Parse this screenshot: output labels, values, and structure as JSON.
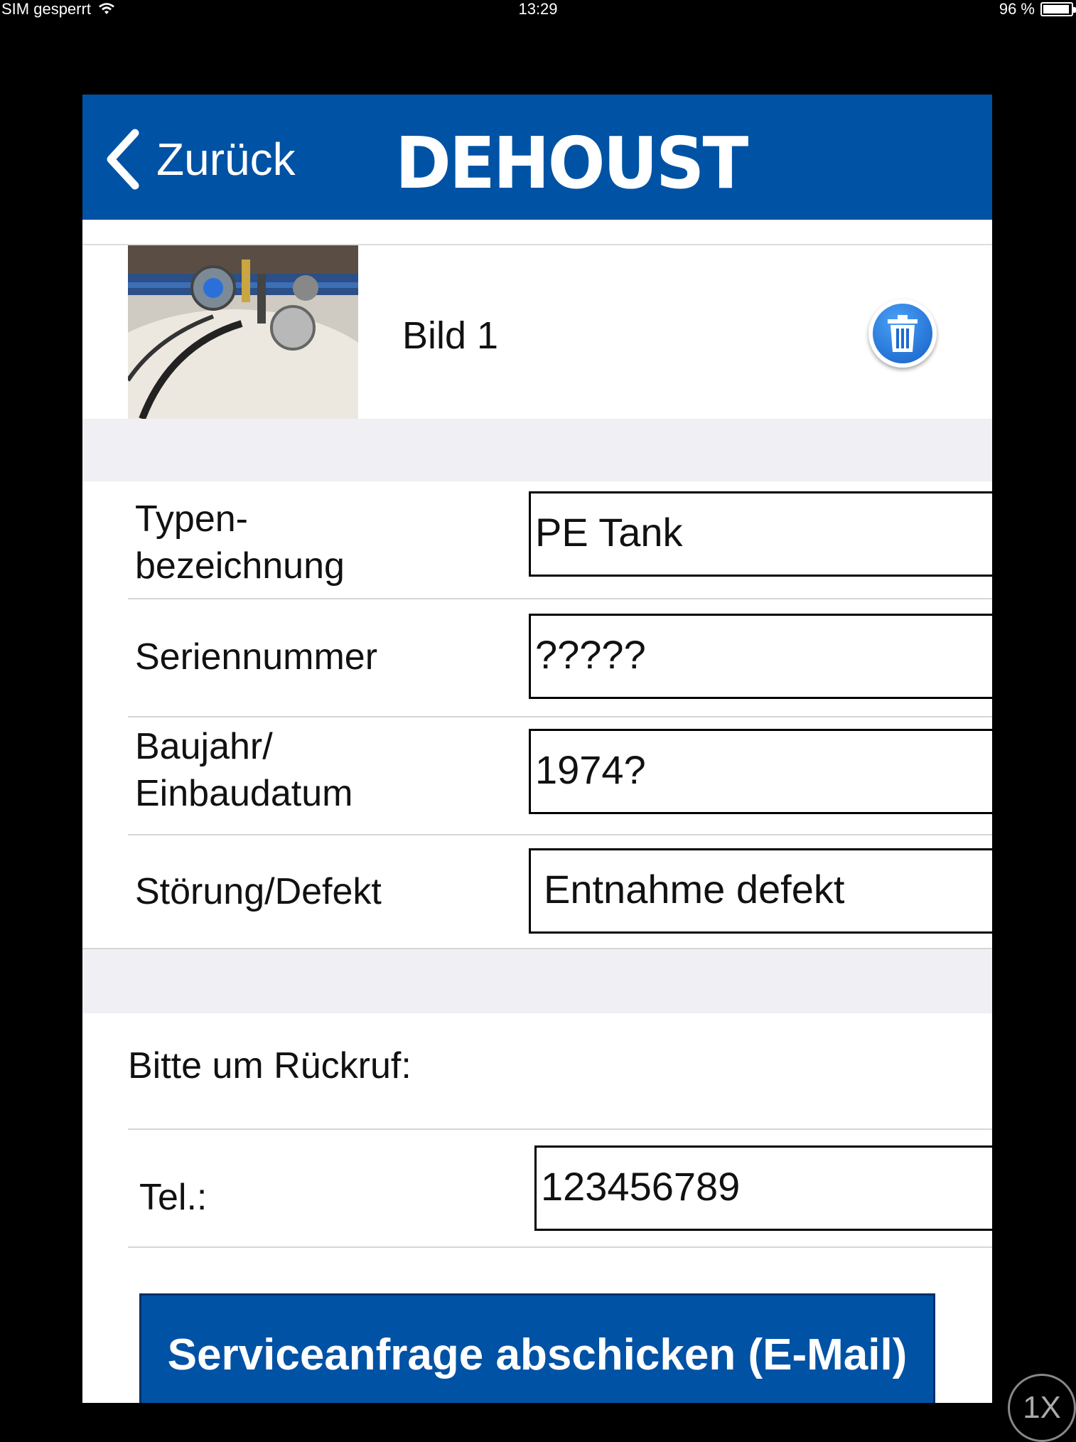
{
  "status_bar": {
    "carrier": "SIM gesperrt",
    "time": "13:29",
    "battery": "96 %",
    "battery_level": 0.96
  },
  "nav": {
    "back_label": "Zurück",
    "logo": "DEHOUST",
    "color": "#0052a4"
  },
  "image_row": {
    "label": "Bild 1",
    "delete_icon": "trash-icon"
  },
  "fields": [
    {
      "label": "Typen-\nbezeichnung",
      "value": "PE Tank"
    },
    {
      "label": "Seriennummer",
      "value": "?????"
    },
    {
      "label": "Baujahr/\nEinbaudatum",
      "value": "1974?"
    },
    {
      "label": "Störung/Defekt",
      "value": "Entnahme defekt"
    }
  ],
  "callback": {
    "title": "Bitte um Rückruf:",
    "phone_label": "Tel.:",
    "phone_value": "123456789"
  },
  "submit_label": "Serviceanfrage abschicken (E-Mail)",
  "zoom_label": "1X"
}
